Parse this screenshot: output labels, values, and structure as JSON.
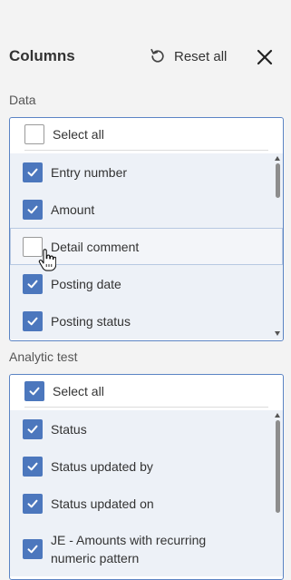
{
  "header": {
    "title": "Columns",
    "reset_label": "Reset all",
    "reset_icon": "reset-icon",
    "close_icon": "close-icon"
  },
  "data_section": {
    "label": "Data",
    "select_all": {
      "label": "Select all",
      "checked": false
    },
    "items": [
      {
        "label": "Entry number",
        "checked": true
      },
      {
        "label": "Amount",
        "checked": true
      },
      {
        "label": "Detail comment",
        "checked": false,
        "hovered": true
      },
      {
        "label": "Posting date",
        "checked": true
      },
      {
        "label": "Posting status",
        "checked": true
      }
    ]
  },
  "analytic_section": {
    "label": "Analytic test",
    "select_all": {
      "label": "Select all",
      "checked": true
    },
    "items": [
      {
        "label": "Status",
        "checked": true
      },
      {
        "label": "Status updated by",
        "checked": true
      },
      {
        "label": "Status updated on",
        "checked": true
      },
      {
        "label": "JE - Amounts with recurring numeric pattern",
        "checked": true
      }
    ]
  },
  "colors": {
    "accent": "#4c77bd",
    "panel_border": "#5b84c4",
    "list_background": "#edf1f7",
    "page_background": "#f3f3f3"
  }
}
